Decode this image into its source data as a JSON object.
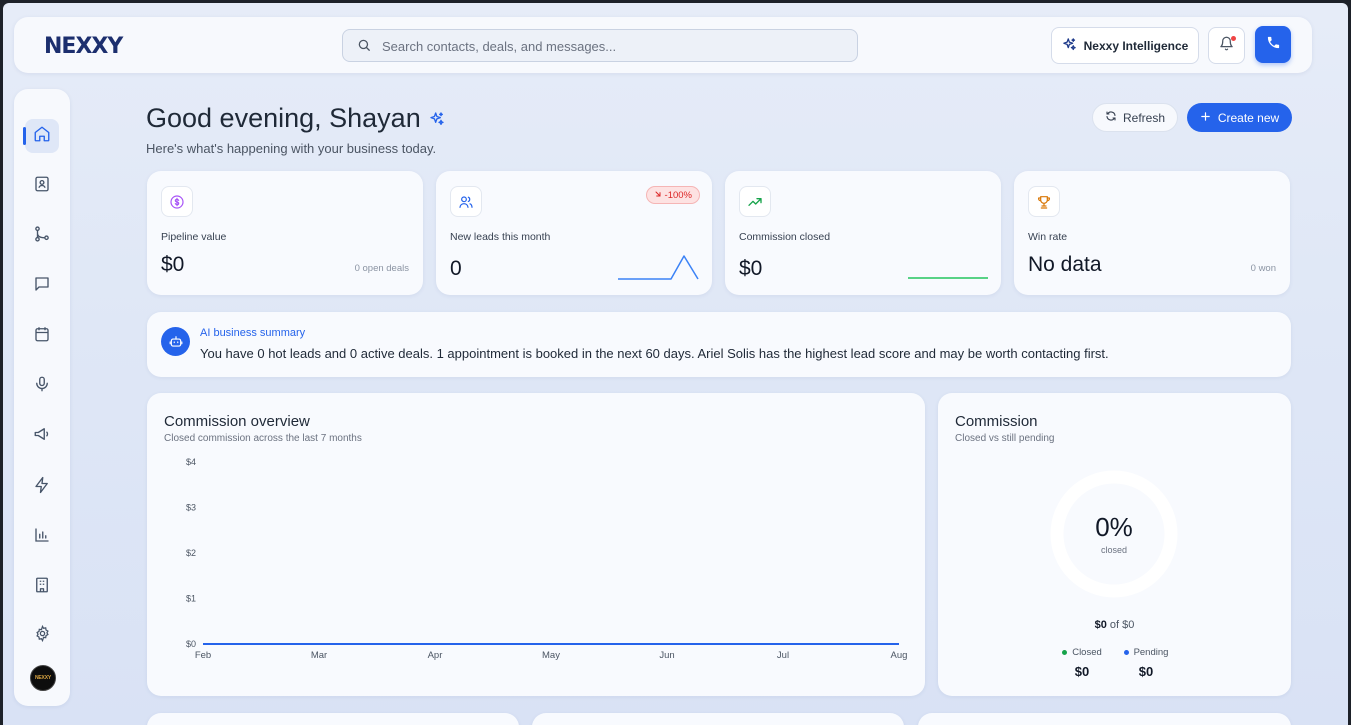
{
  "brand": {
    "logo_text": "NEXXY",
    "avatar_text": "NEXXY"
  },
  "search": {
    "placeholder": "Search contacts, deals, and messages..."
  },
  "topbar": {
    "intelligence_label": "Nexxy Intelligence"
  },
  "sidebar": {
    "items": [
      {
        "name": "home",
        "active": true
      },
      {
        "name": "contacts",
        "active": false
      },
      {
        "name": "pipeline",
        "active": false
      },
      {
        "name": "messages",
        "active": false
      },
      {
        "name": "calendar",
        "active": false
      },
      {
        "name": "voice",
        "active": false
      },
      {
        "name": "campaigns",
        "active": false
      },
      {
        "name": "automations",
        "active": false
      },
      {
        "name": "reports",
        "active": false
      },
      {
        "name": "company",
        "active": false
      },
      {
        "name": "settings",
        "active": false
      }
    ]
  },
  "header": {
    "greeting": "Good evening, Shayan",
    "subtitle": "Here's what's happening with your business today.",
    "refresh_label": "Refresh",
    "create_label": "Create new"
  },
  "stats": [
    {
      "label": "Pipeline value",
      "value": "$0",
      "note": "0 open deals"
    },
    {
      "label": "New leads this month",
      "value": "0",
      "badge": "-100%"
    },
    {
      "label": "Commission closed",
      "value": "$0"
    },
    {
      "label": "Win rate",
      "value": "No data",
      "note": "0 won"
    }
  ],
  "ai_summary": {
    "title": "AI business summary",
    "text": "You have 0 hot leads and 0 active deals. 1 appointment is booked in the next 60 days. Ariel Solis has the highest lead score and may be worth contacting first."
  },
  "commission_overview": {
    "title": "Commission overview",
    "subtitle": "Closed commission across the last 7 months"
  },
  "commission": {
    "title": "Commission",
    "subtitle": "Closed vs still pending",
    "percent": "0%",
    "percent_label": "closed",
    "amount_closed": "$0",
    "amount_of": "of $0",
    "legend": [
      {
        "label": "Closed",
        "value": "$0",
        "color": "#16a34a"
      },
      {
        "label": "Pending",
        "value": "$0",
        "color": "#2563eb"
      }
    ]
  },
  "colors": {
    "accent": "#2563eb",
    "success": "#22c55e",
    "danger": "#dc2626"
  },
  "chart_data": {
    "type": "line",
    "title": "Commission overview",
    "x": [
      "Feb",
      "Mar",
      "Apr",
      "May",
      "Jun",
      "Jul",
      "Aug"
    ],
    "y_ticks": [
      "$0",
      "$1",
      "$2",
      "$3",
      "$4"
    ],
    "ylim": [
      0,
      4
    ],
    "series": [
      {
        "values": [
          0,
          0,
          0,
          0,
          0,
          0,
          0
        ],
        "color": "#2563eb"
      }
    ],
    "grid": false
  }
}
